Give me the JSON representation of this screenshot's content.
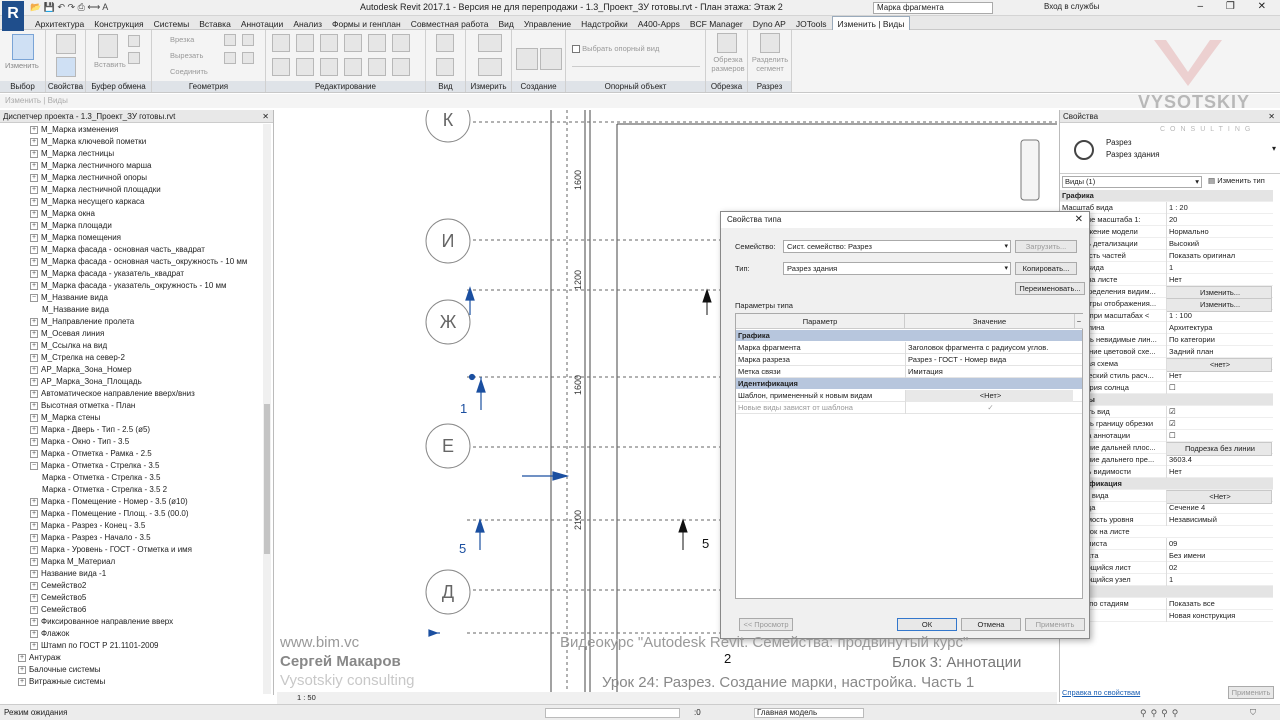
{
  "app": {
    "title": "Autodesk Revit 2017.1 - Версия не для перепродажи -     1.3_Проект_ЗУ готовы.rvt - План этажа: Этаж 2",
    "app_button_label": "R",
    "search_value": "Марка фрагмента",
    "login_label": "Вход в службы",
    "window_controls": "– ❐ ✕"
  },
  "menu": {
    "tabs": [
      "Архитектура",
      "Конструкция",
      "Системы",
      "Вставка",
      "Аннотации",
      "Анализ",
      "Формы и генплан",
      "Совместная работа",
      "Вид",
      "Управление",
      "Надстройки",
      "A400-Apps",
      "BCF Manager",
      "Dyno AP",
      "JOTools",
      "Изменить | Виды"
    ]
  },
  "ribbon": {
    "groups": [
      "Выбор",
      "Свойства",
      "Буфер обмена",
      "Геометрия",
      "Редактирование",
      "Вид",
      "Измерить",
      "Создание",
      "Опорный объект",
      "Обрезка",
      "Разрез"
    ],
    "modify_label": "Изменить",
    "paste_label": "Вставить",
    "cut_label": "Врезка",
    "cut2_label": "Вырезать",
    "join_label": "Соединить",
    "ref_view_label": "Выбрать опорный вид",
    "crop_label": "Обрезка размеров",
    "split_label": "Разделить сегмент",
    "status_hint": "Изменить | Виды"
  },
  "browser": {
    "title": "Диспетчер проекта - 1.3_Проект_ЗУ готовы.rvt",
    "items": [
      {
        "t": "М_Марка изменения",
        "l": 1,
        "g": "+"
      },
      {
        "t": "М_Марка ключевой пометки",
        "l": 1,
        "g": "+"
      },
      {
        "t": "М_Марка лестницы",
        "l": 1,
        "g": "+"
      },
      {
        "t": "М_Марка лестничного марша",
        "l": 1,
        "g": "+"
      },
      {
        "t": "М_Марка лестничной опоры",
        "l": 1,
        "g": "+"
      },
      {
        "t": "М_Марка лестничной площадки",
        "l": 1,
        "g": "+"
      },
      {
        "t": "М_Марка несущего каркаса",
        "l": 1,
        "g": "+"
      },
      {
        "t": "М_Марка окна",
        "l": 1,
        "g": "+"
      },
      {
        "t": "М_Марка площади",
        "l": 1,
        "g": "+"
      },
      {
        "t": "М_Марка помещения",
        "l": 1,
        "g": "+"
      },
      {
        "t": "М_Марка фасада - основная часть_квадрат",
        "l": 1,
        "g": "+"
      },
      {
        "t": "М_Марка фасада - основная часть_окружность - 10 мм",
        "l": 1,
        "g": "+"
      },
      {
        "t": "М_Марка фасада - указатель_квадрат",
        "l": 1,
        "g": "+"
      },
      {
        "t": "М_Марка фасада - указатель_окружность - 10 мм",
        "l": 1,
        "g": "+"
      },
      {
        "t": "М_Название вида",
        "l": 1,
        "g": "−"
      },
      {
        "t": "М_Название вида",
        "l": 2,
        "g": ""
      },
      {
        "t": "М_Направление пролета",
        "l": 1,
        "g": "+"
      },
      {
        "t": "М_Осевая линия",
        "l": 1,
        "g": "+"
      },
      {
        "t": "М_Ссылка на вид",
        "l": 1,
        "g": "+"
      },
      {
        "t": "М_Стрелка на север-2",
        "l": 1,
        "g": "+"
      },
      {
        "t": "АР_Марка_Зона_Номер",
        "l": 1,
        "g": "+"
      },
      {
        "t": "АР_Марка_Зона_Площадь",
        "l": 1,
        "g": "+"
      },
      {
        "t": "Автоматическое направление вверх/вниз",
        "l": 1,
        "g": "+"
      },
      {
        "t": "Высотная отметка - План",
        "l": 1,
        "g": "+"
      },
      {
        "t": "М_Марка стены",
        "l": 1,
        "g": "+"
      },
      {
        "t": "Марка - Дверь - Тип - 2.5 (ø5)",
        "l": 1,
        "g": "+"
      },
      {
        "t": "Марка - Окно - Тип - 3.5",
        "l": 1,
        "g": "+"
      },
      {
        "t": "Марка - Отметка - Рамка - 2.5",
        "l": 1,
        "g": "+"
      },
      {
        "t": "Марка - Отметка - Стрелка - 3.5",
        "l": 1,
        "g": "−"
      },
      {
        "t": "Марка - Отметка - Стрелка - 3.5",
        "l": 2,
        "g": ""
      },
      {
        "t": "Марка - Отметка - Стрелка - 3.5 2",
        "l": 2,
        "g": ""
      },
      {
        "t": "Марка - Помещение - Номер - 3.5 (ø10)",
        "l": 1,
        "g": "+"
      },
      {
        "t": "Марка - Помещение - Площ. - 3.5 (00.0)",
        "l": 1,
        "g": "+"
      },
      {
        "t": "Марка - Разрез - Конец - 3.5",
        "l": 1,
        "g": "+"
      },
      {
        "t": "Марка - Разрез - Начало - 3.5",
        "l": 1,
        "g": "+"
      },
      {
        "t": "Марка - Уровень - ГОСТ - Отметка и имя",
        "l": 1,
        "g": "+"
      },
      {
        "t": "Марка М_Материал",
        "l": 1,
        "g": "+"
      },
      {
        "t": "Название вида -1",
        "l": 1,
        "g": "+"
      },
      {
        "t": "Семейство2",
        "l": 1,
        "g": "+"
      },
      {
        "t": "Семейство5",
        "l": 1,
        "g": "+"
      },
      {
        "t": "Семейство6",
        "l": 1,
        "g": "+"
      },
      {
        "t": "Фиксированное направление вверх",
        "l": 1,
        "g": "+"
      },
      {
        "t": "Флажок",
        "l": 1,
        "g": "+"
      },
      {
        "t": "Штамп по ГОСТ Р 21.1101-2009",
        "l": 1,
        "g": "+"
      },
      {
        "t": "Антураж",
        "l": 0,
        "g": "+"
      },
      {
        "t": "Балочные системы",
        "l": 0,
        "g": "+"
      },
      {
        "t": "Витражные системы",
        "l": 0,
        "g": "+"
      }
    ]
  },
  "canvas": {
    "grid_bubbles": [
      "К",
      "И",
      "Ж",
      "Е",
      "Д"
    ],
    "dims": [
      "1600",
      "1200",
      "1600",
      "2100"
    ],
    "numbers": [
      "1",
      "5",
      "5",
      "2"
    ],
    "scale_label": "1 : 50"
  },
  "dialog": {
    "title": "Свойства типа",
    "family_label": "Семейство:",
    "family_value": "Сист. семейство: Разрез",
    "type_label": "Тип:",
    "type_value": "Разрез здания",
    "load_btn": "Загрузить...",
    "copy_btn": "Копировать...",
    "rename_btn": "Переименовать...",
    "params_label": "Параметры типа",
    "col_param": "Параметр",
    "col_value": "Значение",
    "sections": [
      {
        "name": "Графика",
        "rows": [
          {
            "p": "Марка фрагмента",
            "v": "Заголовок фрагмента с радиусом углов.",
            "dis": false
          },
          {
            "p": "Марка разреза",
            "v": "Разрез - ГОСТ - Номер вида",
            "dis": false
          },
          {
            "p": "Метка связи",
            "v": "Имитация",
            "dis": false
          }
        ]
      },
      {
        "name": "Идентификация",
        "rows": [
          {
            "p": "Шаблон, примененный к новым видам",
            "v": "<Нет>",
            "dis": false
          },
          {
            "p": "Новые виды зависят от шаблона",
            "v": "✓",
            "dis": true
          }
        ]
      }
    ],
    "preview_btn": "<< Просмотр",
    "ok_btn": "ОК",
    "cancel_btn": "Отмена",
    "apply_btn": "Применить"
  },
  "props": {
    "title": "Свойства",
    "type_name": "Разрез",
    "type_sub": "Разрез здания",
    "views_select": "Виды (1)",
    "edit_type_btn": "Изменить тип",
    "rows": [
      {
        "n": "Графика",
        "v": "",
        "sec": true
      },
      {
        "n": "Масштаб вида",
        "v": "1 : 20"
      },
      {
        "n": "Значение масштаба   1:",
        "v": "20"
      },
      {
        "n": "Отображение модели",
        "v": "Нормально"
      },
      {
        "n": "Уровень детализации",
        "v": "Высокий"
      },
      {
        "n": "Видимость частей",
        "v": "Показать оригинал"
      },
      {
        "n": "Номер вида",
        "v": "1"
      },
      {
        "n": "Номер на листе",
        "v": "Нет"
      },
      {
        "n": "Переопределения видим...",
        "v": "Изменить...",
        "btn": true
      },
      {
        "n": "Параметры отображения...",
        "v": "Изменить...",
        "btn": true
      },
      {
        "n": "Скрыть при масштабах <",
        "v": "1 : 100"
      },
      {
        "n": "Дисциплина",
        "v": "Архитектура"
      },
      {
        "n": "Показать невидимые лин...",
        "v": "По категории"
      },
      {
        "n": "Положение цветовой схе...",
        "v": "Задний план"
      },
      {
        "n": "Цветовая схема",
        "v": "<нет>",
        "btn": true
      },
      {
        "n": "Графический стиль расч...",
        "v": "Нет"
      },
      {
        "n": "Траектория солнца",
        "v": "☐"
      },
      {
        "n": "Границы",
        "v": "",
        "sec": true
      },
      {
        "n": "Обрезать вид",
        "v": "☑"
      },
      {
        "n": "Показать границу обрезки",
        "v": "☑"
      },
      {
        "n": "Обрезка аннотации",
        "v": "☐"
      },
      {
        "n": "Отсечение дальней плос...",
        "v": "Подрезка без линии",
        "btn": true
      },
      {
        "n": "Смещение дальнего пре...",
        "v": "3603.4"
      },
      {
        "n": "Область видимости",
        "v": "Нет"
      },
      {
        "n": "Идентификация",
        "v": "",
        "sec": true
      },
      {
        "n": "Шаблон вида",
        "v": "<Нет>",
        "btn": true
      },
      {
        "n": "Имя вида",
        "v": "Сечение 4"
      },
      {
        "n": "Зависимость уровня",
        "v": "Независимый"
      },
      {
        "n": "Заголовок на листе",
        "v": ""
      },
      {
        "n": "Номер листа",
        "v": "09"
      },
      {
        "n": "Имя листа",
        "v": "Без имени"
      },
      {
        "n": "Ссылающийся лист",
        "v": "02"
      },
      {
        "n": "Ссылающийся узел",
        "v": "1"
      },
      {
        "n": "Стадии",
        "v": "",
        "sec": true
      },
      {
        "n": "Фильтр по стадиям",
        "v": "Показать все"
      },
      {
        "n": "Стадия",
        "v": "Новая конструкция"
      }
    ],
    "help_link": "Справка по свойствам",
    "apply_btn": "Применить"
  },
  "status": {
    "text": "Режим ожидания",
    "zoom": ":0",
    "model": "Главная модель"
  },
  "overlay": {
    "site": "www.bim.vc",
    "author": "Сергей Макаров",
    "company": "Vysotskiy consulting",
    "course": "Видеокурс \"Autodesk Revit. Семейства: продвинутый курс\"",
    "block": "Блок 3: Аннотации",
    "lesson": "Урок 24: Разрез. Создание марки, настройка. Часть 1",
    "logo_text": "VYSOTSKIY",
    "logo_sub": "CONSULTING"
  },
  "colors": {
    "accent": "#1f4e8c",
    "section_blue": "#b7c6dd",
    "canvas_blue": "#1b4fa0"
  }
}
